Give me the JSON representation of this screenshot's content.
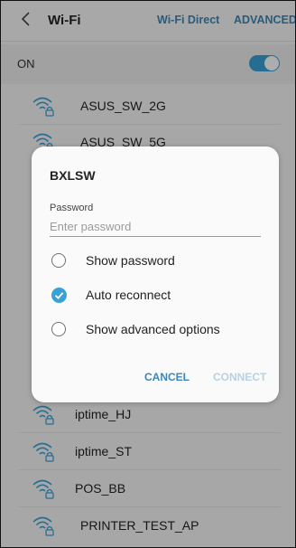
{
  "header": {
    "title": "Wi-Fi",
    "wifi_direct": "Wi-Fi Direct",
    "advanced": "ADVANCED"
  },
  "wifi_toggle": {
    "label": "ON",
    "on": true,
    "color": "#3aa1d8"
  },
  "networks_above": [
    {
      "name": "ASUS_SW_2G",
      "icon": "wifi-lock-icon"
    },
    {
      "name": "ASUS_SW_5G",
      "icon": "wifi-lock-icon"
    }
  ],
  "networks_below": [
    {
      "name": "iptime_HJ",
      "icon": "wifi-lock-icon"
    },
    {
      "name": "iptime_ST",
      "icon": "wifi-lock-icon"
    },
    {
      "name": "POS_BB",
      "icon": "wifi-lock-icon"
    },
    {
      "name": "PRINTER_TEST_AP",
      "icon": "wifi-lock-icon"
    }
  ],
  "dialog": {
    "network_name": "BXLSW",
    "password_label": "Password",
    "password_placeholder": "Enter password",
    "password_value": "",
    "options": [
      {
        "label": "Show password",
        "checked": false
      },
      {
        "label": "Auto reconnect",
        "checked": true
      },
      {
        "label": "Show advanced options",
        "checked": false
      }
    ],
    "cancel_label": "CANCEL",
    "connect_label": "CONNECT",
    "connect_enabled": false
  },
  "colors": {
    "accent": "#3aa1d8",
    "link": "#3b87b9",
    "disabled": "#b8d2e2"
  }
}
